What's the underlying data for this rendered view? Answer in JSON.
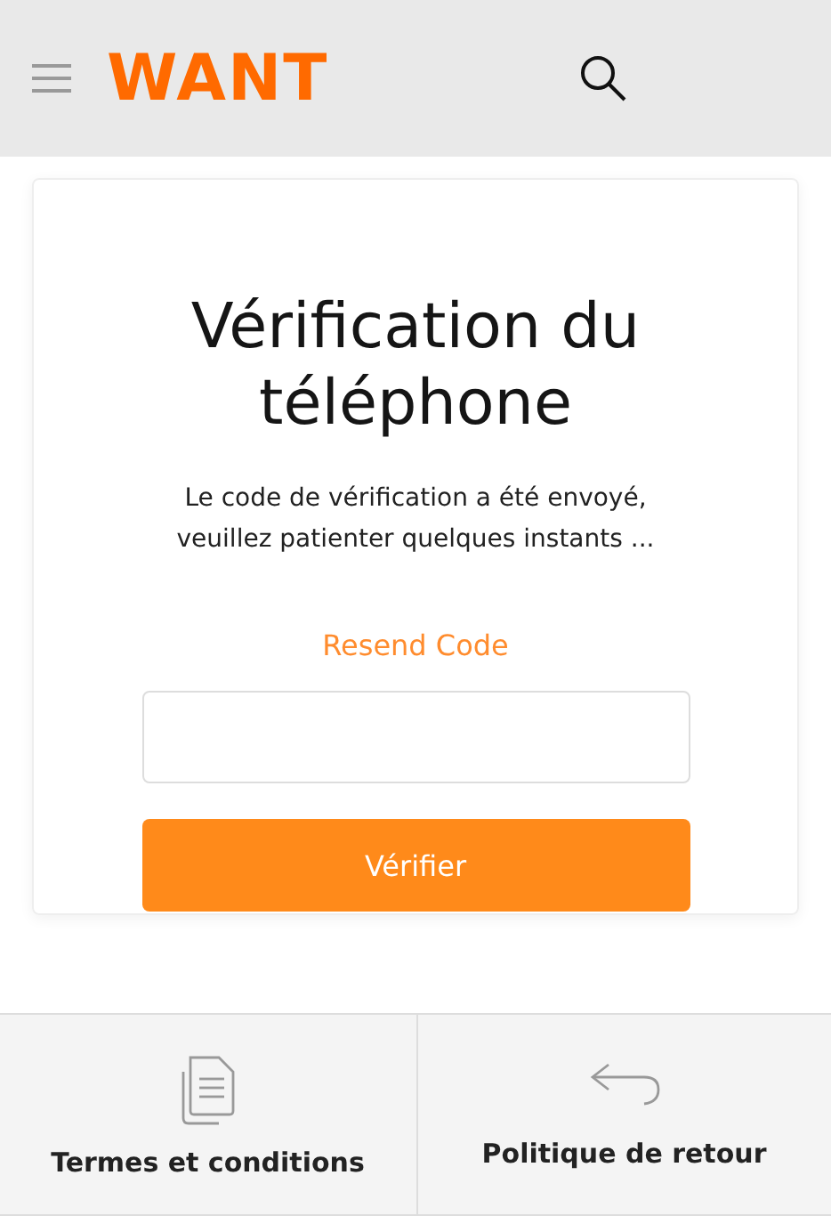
{
  "header": {
    "logo": "WANT"
  },
  "card": {
    "title": "Vérification du téléphone",
    "message": "Le code de vérification a été envoyé, veuillez patienter quelques instants ...",
    "resend_link": "Resend Code",
    "verify_button": "Vérifier"
  },
  "footer_links": [
    {
      "label": "Termes et conditions",
      "kind": "document"
    },
    {
      "label": "Politique de retour",
      "kind": "return"
    }
  ]
}
